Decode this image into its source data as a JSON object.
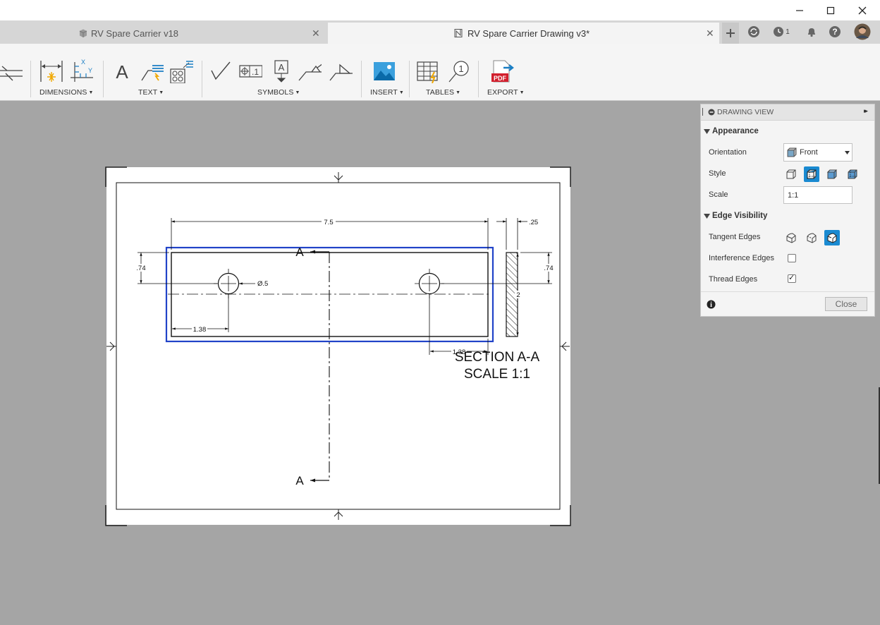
{
  "window": {
    "minimize_glyph": "—",
    "maximize_glyph": "☐",
    "close_glyph": "✕"
  },
  "tabs": [
    {
      "label": "RV Spare Carrier v18",
      "icon": "3d-model-icon",
      "close": "✕",
      "active": false
    },
    {
      "label": "RV Spare Carrier Drawing v3*",
      "icon": "drawing-icon",
      "close": "✕",
      "active": true
    }
  ],
  "toolbar_right": {
    "new_tab_icon": "plus-icon",
    "sync_icon": "sync-status-icon",
    "job_count": "1",
    "job_icon": "job-status-icon",
    "notification_icon": "bell-icon",
    "help_icon": "help-icon",
    "avatar_icon": "user-avatar"
  },
  "ribbon": {
    "groups": [
      {
        "label": "DIMENSIONS",
        "tools": [
          "linear-dimension-icon",
          "ordinate-dimension-icon"
        ]
      },
      {
        "label": "TEXT",
        "tools": [
          "text-icon",
          "leader-icon",
          "balloon-grid-icon"
        ]
      },
      {
        "label": "SYMBOLS",
        "tools": [
          "surface-texture-icon",
          "feature-control-frame-icon",
          "datum-identifier-icon",
          "welding-symbol-icon",
          "taper-symbol-icon"
        ]
      },
      {
        "label": "INSERT",
        "tools": [
          "insert-image-icon"
        ]
      },
      {
        "label": "TABLES",
        "tools": [
          "table-icon",
          "balloon-icon"
        ]
      },
      {
        "label": "EXPORT",
        "tools": [
          "pdf-export-icon"
        ]
      }
    ],
    "caret": "▼",
    "tool_text": {
      "text_glyph": "A",
      "fcf_text": ".1",
      "datum_text": "A",
      "balloon_text": "1",
      "pdf_text": "PDF",
      "axis_x": "X",
      "axis_y": "Y"
    }
  },
  "drawing": {
    "dim_overall_length": "7.5",
    "dim_thickness": ".25",
    "dim_hole_y_left": ".74",
    "dim_hole_y_right": ".74",
    "dim_hole_diameter": "Ø.5",
    "dim_hole1_x": "1.38",
    "dim_hole2_x": "1.38",
    "dim_section_height": "2",
    "section_marker_top": "A",
    "section_marker_bottom": "A",
    "section_title": "SECTION A-A",
    "section_scale": "SCALE 1:1"
  },
  "panel": {
    "title": "DRAWING VIEW",
    "expand_glyph": "▸▸",
    "sections": {
      "appearance": "Appearance",
      "edge_visibility": "Edge Visibility"
    },
    "orientation": {
      "label": "Orientation",
      "value": "Front"
    },
    "style": {
      "label": "Style",
      "selected_index": 1,
      "options": [
        "visible-edges-icon",
        "visible-hidden-edges-icon",
        "shaded-icon",
        "shaded-hidden-edges-icon"
      ]
    },
    "scale": {
      "label": "Scale",
      "value": "1:1"
    },
    "tangent_edges": {
      "label": "Tangent Edges",
      "selected_index": 2
    },
    "interference_edges": {
      "label": "Interference Edges",
      "checked": false
    },
    "thread_edges": {
      "label": "Thread Edges",
      "checked": true
    },
    "check_glyph": "✓",
    "info_glyph": "i",
    "close_button": "Close"
  },
  "colors": {
    "canvas": "#a5a5a5",
    "selection": "#2143c8",
    "accent": "#1a8ad1"
  }
}
